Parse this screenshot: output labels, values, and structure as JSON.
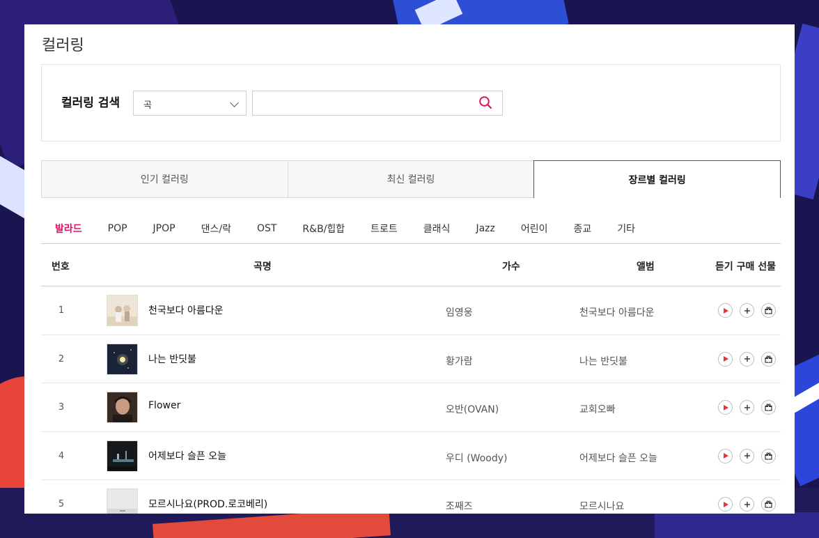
{
  "page": {
    "title": "컬러링"
  },
  "search": {
    "label": "컬러링 검색",
    "select_value": "곡",
    "input_value": "",
    "input_placeholder": ""
  },
  "tabs": [
    {
      "label": "인기 컬러링",
      "active": false
    },
    {
      "label": "최신 컬러링",
      "active": false
    },
    {
      "label": "장르별 컬러링",
      "active": true
    }
  ],
  "genres": [
    {
      "label": "발라드",
      "active": true
    },
    {
      "label": "POP"
    },
    {
      "label": "JPOP"
    },
    {
      "label": "댄스/락"
    },
    {
      "label": "OST"
    },
    {
      "label": "R&B/힙합"
    },
    {
      "label": "트로트"
    },
    {
      "label": "클래식"
    },
    {
      "label": "Jazz"
    },
    {
      "label": "어린이"
    },
    {
      "label": "종교"
    },
    {
      "label": "기타"
    }
  ],
  "table": {
    "headers": {
      "no": "번호",
      "song": "곡명",
      "artist": "가수",
      "album": "앨범",
      "actions": "듣기 구매 선물"
    },
    "rows": [
      {
        "no": "1",
        "title": "천국보다 아름다운",
        "artist": "임영웅",
        "album": "천국보다 아름다운"
      },
      {
        "no": "2",
        "title": "나는 반딧불",
        "artist": "황가람",
        "album": "나는 반딧불"
      },
      {
        "no": "3",
        "title": "Flower",
        "artist": "오반(OVAN)",
        "album": "교회오빠"
      },
      {
        "no": "4",
        "title": "어제보다 슬픈 오늘",
        "artist": "우디 (Woody)",
        "album": "어제보다 슬픈 오늘"
      },
      {
        "no": "5",
        "title": "모르시나요(PROD.로코베리)",
        "artist": "조째즈",
        "album": "모르시나요"
      }
    ]
  },
  "colors": {
    "accent": "#e0115f",
    "play": "#e8313a"
  },
  "icons": {
    "search": "search-icon",
    "select": "chevron-down-icon",
    "play": "play-icon",
    "buy": "plus-icon",
    "gift": "gift-icon"
  }
}
